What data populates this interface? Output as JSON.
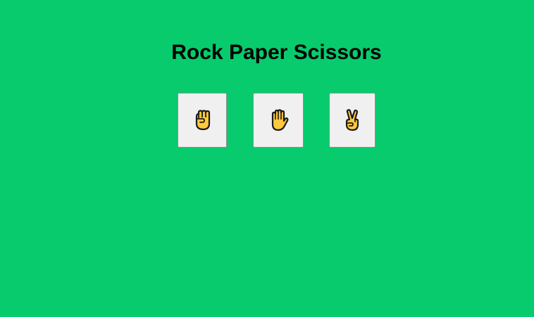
{
  "game": {
    "title": "Rock Paper Scissors",
    "background_color": "#07cb6d",
    "choices": [
      {
        "id": "rock",
        "icon": "raised-fist-icon"
      },
      {
        "id": "paper",
        "icon": "raised-hand-icon"
      },
      {
        "id": "scissors",
        "icon": "victory-hand-icon"
      }
    ],
    "button_color": "#f0f0f0",
    "hand_color": "#ffc83d"
  }
}
